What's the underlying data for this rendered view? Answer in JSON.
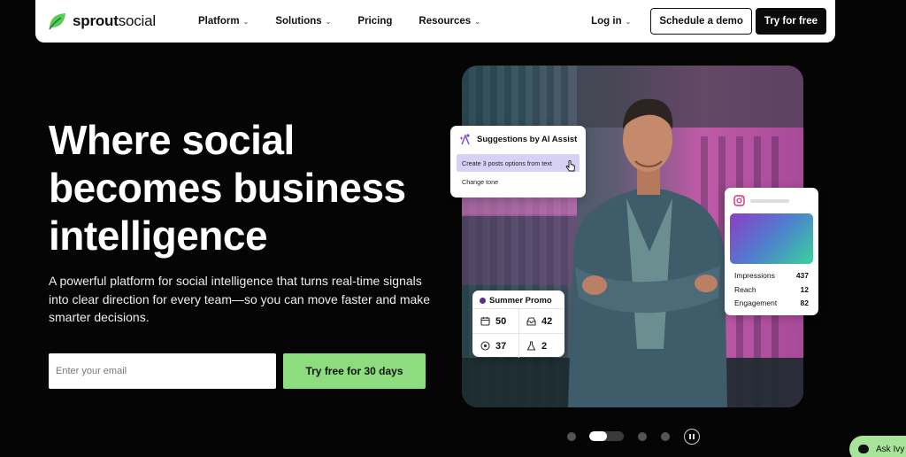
{
  "nav": {
    "brand_bold": "sprout",
    "brand_light": "social",
    "links": [
      {
        "label": "Platform",
        "dropdown": true
      },
      {
        "label": "Solutions",
        "dropdown": true
      },
      {
        "label": "Pricing",
        "dropdown": false
      },
      {
        "label": "Resources",
        "dropdown": true
      }
    ],
    "login": "Log in",
    "demo": "Schedule a demo",
    "try": "Try for free"
  },
  "hero": {
    "headline_1": "Where social",
    "headline_2": "becomes business",
    "headline_3": "intelligence",
    "subtext": "A powerful platform for social intelligence that turns real-time signals into clear direction for every team—so you can move faster and make smarter decisions.",
    "email_placeholder": "Enter your email",
    "cta": "Try free for 30 days"
  },
  "ai_card": {
    "title": "Suggestions by AI Assist",
    "option_1": "Create 3 posts options from text",
    "option_2": "Change tone"
  },
  "instagram_card": {
    "icon": "instagram-icon",
    "stats": [
      {
        "label": "Impressions",
        "value": "437"
      },
      {
        "label": "Reach",
        "value": "12"
      },
      {
        "label": "Engagement",
        "value": "82"
      }
    ]
  },
  "promo_card": {
    "title": "Summer Promo",
    "cells": [
      {
        "icon": "calendar-icon",
        "value": "50"
      },
      {
        "icon": "inbox-icon",
        "value": "42"
      },
      {
        "icon": "eye-icon",
        "value": "37"
      },
      {
        "icon": "flask-icon",
        "value": "2"
      }
    ]
  },
  "carousel": {
    "slides": 4,
    "active_index": 1,
    "active_progress": 0.5
  },
  "chat": {
    "label": "Ask Ivy"
  },
  "colors": {
    "cta": "#8ddc7d",
    "brand": "#59cb59",
    "ai_highlight": "#d8d1f6"
  }
}
